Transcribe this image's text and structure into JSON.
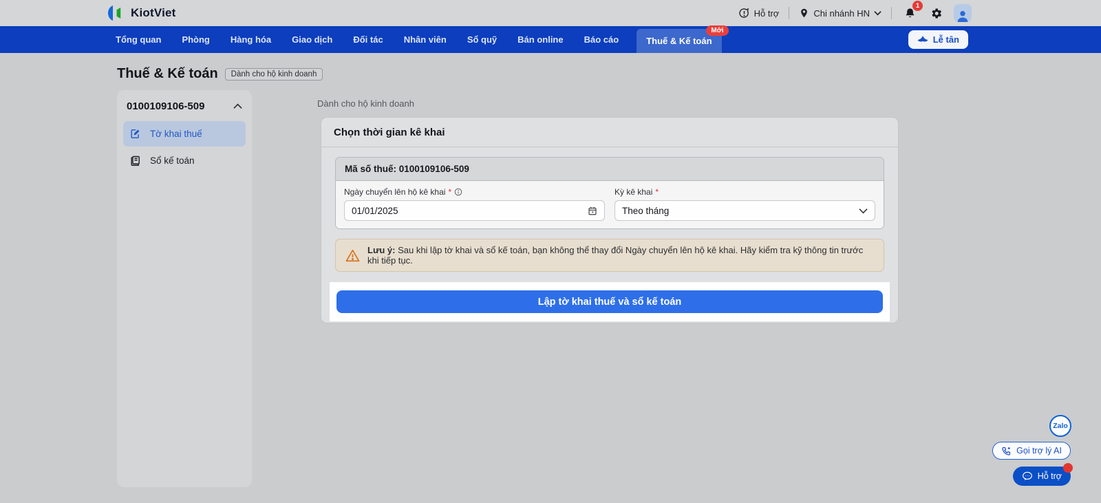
{
  "header": {
    "brand": "KiotViet",
    "support_label": "Hỗ trợ",
    "branch_label": "Chi nhánh HN",
    "notification_count": "1"
  },
  "nav": {
    "tabs": [
      "Tổng quan",
      "Phòng",
      "Hàng hóa",
      "Giao dịch",
      "Đối tác",
      "Nhân viên",
      "Sổ quỹ",
      "Bán online",
      "Báo cáo"
    ],
    "active_tab": {
      "label": "Thuế & Kế toán",
      "badge": "Mới"
    },
    "receptionist_label": "Lễ tân"
  },
  "page": {
    "title": "Thuế & Kế toán",
    "title_badge": "Dành cho hộ kinh doanh"
  },
  "sidebar": {
    "group_label": "0100109106-509",
    "items": [
      {
        "label": "Tờ khai thuế",
        "active": true
      },
      {
        "label": "Sổ kế toán",
        "active": false
      }
    ]
  },
  "main": {
    "subtitle": "Dành cho hộ kinh doanh",
    "card_title": "Chọn thời gian kê khai",
    "tax_code_label": "Mã số thuế: 0100109106-509",
    "date_field": {
      "label": "Ngày chuyển lên hộ kê khai",
      "required_mark": "*",
      "value": "01/01/2025"
    },
    "period_field": {
      "label": "Kỳ kê khai",
      "required_mark": "*",
      "value": "Theo tháng"
    },
    "warning": {
      "bold": "Lưu ý:",
      "text": " Sau khi lập tờ khai và sổ kế toán, bạn không thể thay đổi Ngày chuyển lên hộ kê khai. Hãy kiểm tra kỹ thông tin trước khi tiếp tục."
    },
    "submit_label": "Lập tờ khai thuế và sổ kế toán"
  },
  "floating": {
    "zalo_label": "Zalo",
    "ai_call_label": "Gọi trợ lý AI",
    "support_label": "Hỗ trợ"
  },
  "colors": {
    "navbar_blue": "#0c3ebd",
    "active_tab_blue": "#3d68cc",
    "badge_red": "#e8403c",
    "button_blue": "#2e6fe9",
    "link_blue": "#1b50c6",
    "warning_bg": "#e7decf",
    "warning_icon_orange": "#d9731f"
  }
}
